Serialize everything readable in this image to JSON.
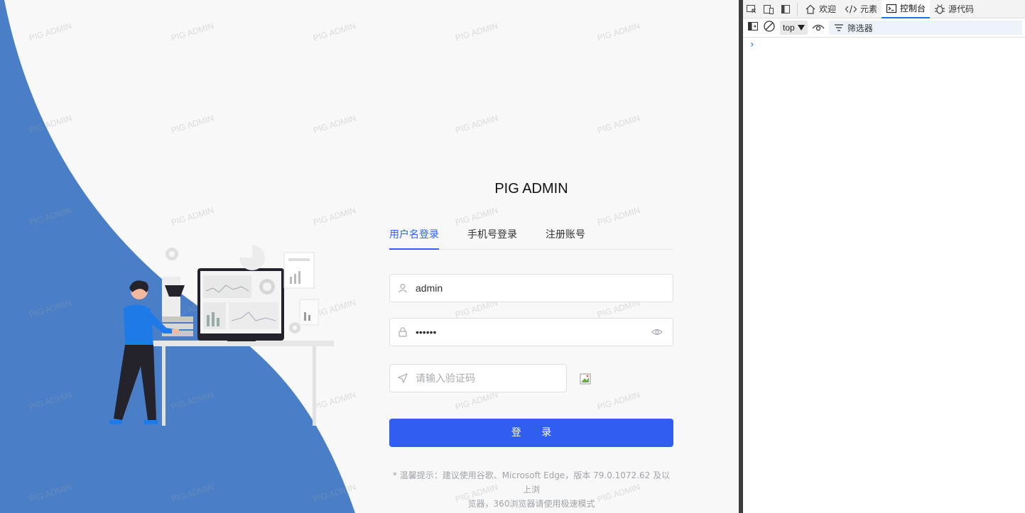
{
  "app": {
    "brand": "PIG ADMIN",
    "watermark": "PIG ADMIN",
    "accent_color": "#2962ff",
    "wave_color": "#4a7fc8"
  },
  "login": {
    "tabs": [
      {
        "label": "用户名登录",
        "active": true
      },
      {
        "label": "手机号登录",
        "active": false
      },
      {
        "label": "注册账号",
        "active": false
      }
    ],
    "username": {
      "value": "admin",
      "icon": "user-icon"
    },
    "password": {
      "value": "••••••",
      "icon": "lock-icon",
      "suffix_icon": "eye-icon"
    },
    "captcha": {
      "placeholder": "请输入验证码",
      "icon": "send-icon",
      "image": "broken-image-icon"
    },
    "submit_label": "登 录",
    "tip_line1": "* 温馨提示：建议使用谷歌、Microsoft Edge，版本 79.0.1072.62 及以上浏",
    "tip_line2": "览器，360浏览器请使用极速模式"
  },
  "devtools": {
    "tabs": [
      {
        "label": "欢迎",
        "icon": "home-icon"
      },
      {
        "label": "元素",
        "icon": "code-icon"
      },
      {
        "label": "控制台",
        "icon": "console-icon",
        "active": true
      },
      {
        "label": "源代码",
        "icon": "bug-icon"
      }
    ],
    "context": "top",
    "filter_label": "筛选器",
    "prompt_symbol": "›"
  }
}
